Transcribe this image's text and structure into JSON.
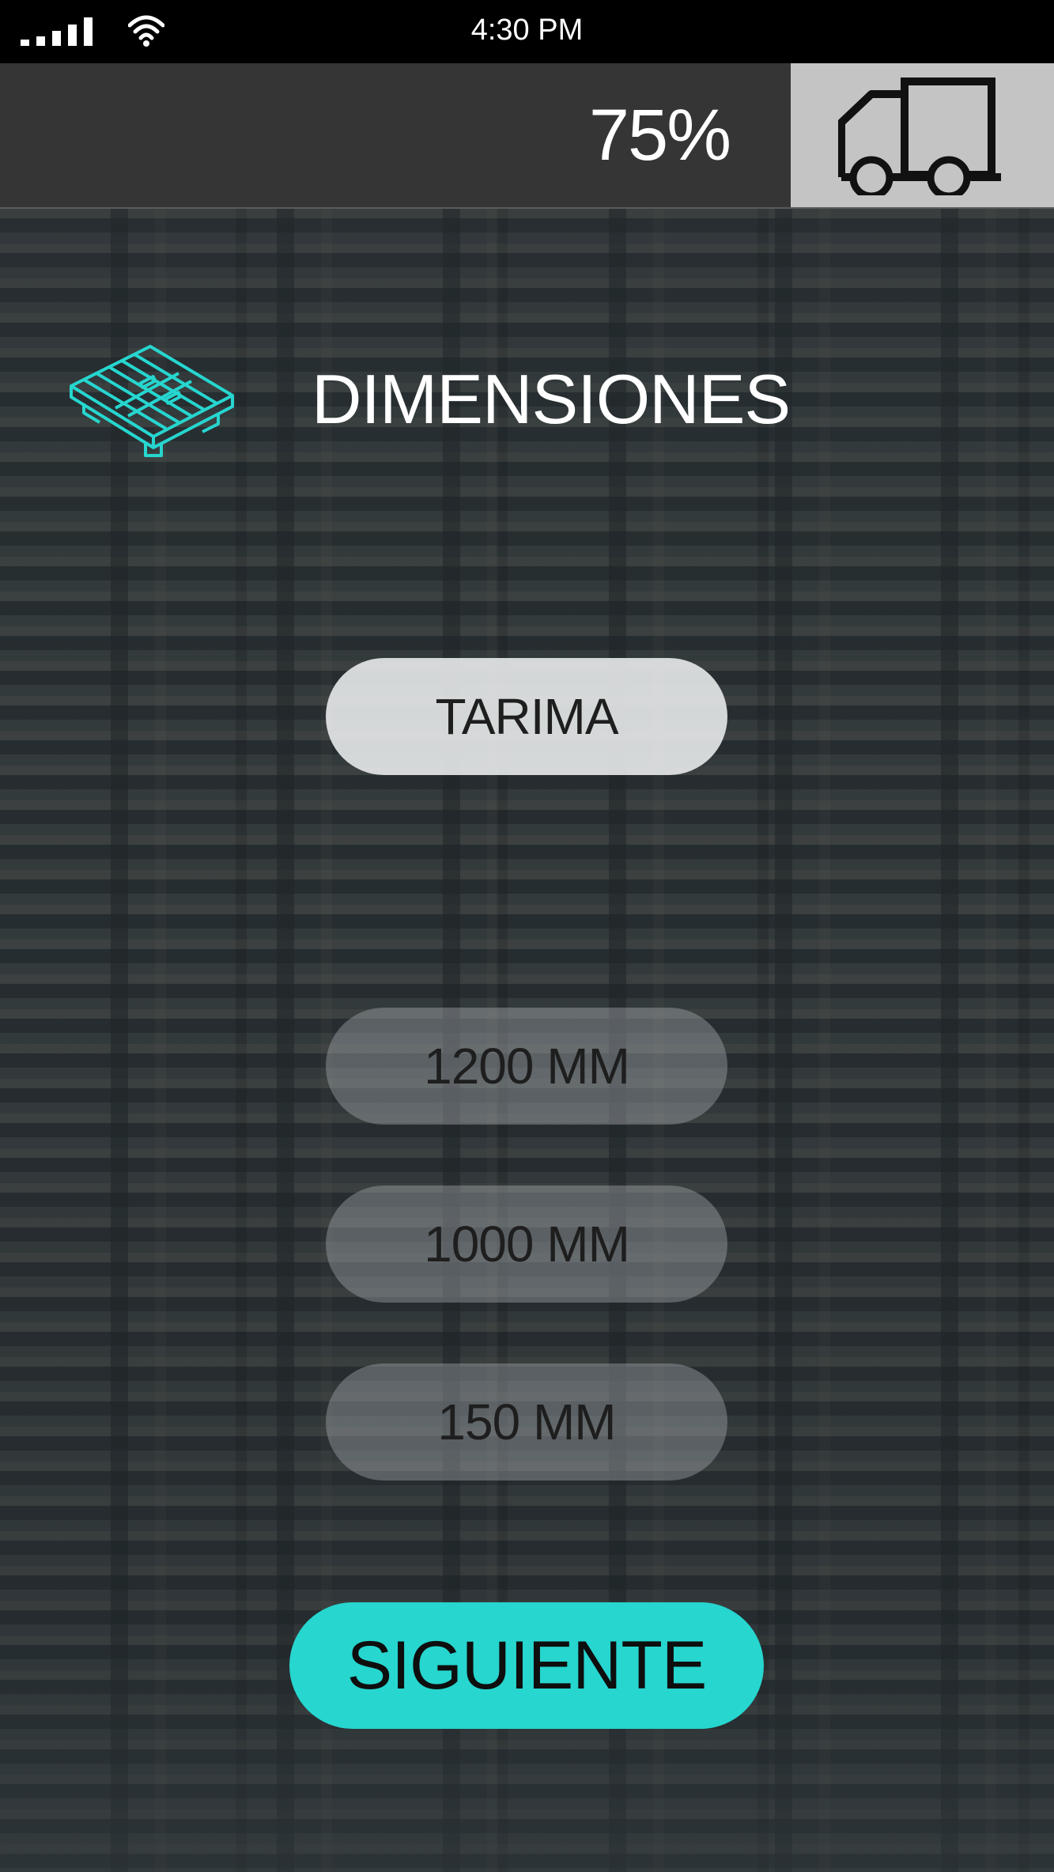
{
  "status_bar": {
    "time": "4:30 PM",
    "signal_icon": "signal-bars-icon",
    "wifi_icon": "wifi-icon"
  },
  "header": {
    "progress": "75%",
    "progress_fraction": 0.75,
    "truck_icon": "truck-icon",
    "truck_button_color": "#c4c4c4"
  },
  "section": {
    "icon": "pallet-icon",
    "title": "DIMENSIONES",
    "accent_color": "#26d6cf"
  },
  "options": {
    "type": "TARIMA",
    "length": "1200 MM",
    "width": "1000 MM",
    "height": "150 MM"
  },
  "actions": {
    "next_label": "SIGUIENTE",
    "next_color": "#26d6cf"
  }
}
